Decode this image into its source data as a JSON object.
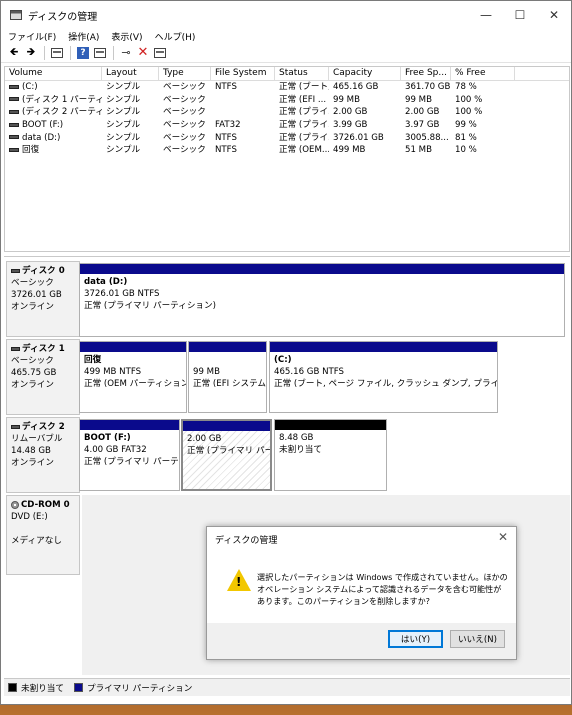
{
  "window": {
    "title": "ディスクの管理",
    "controls": [
      "—",
      "☐",
      "✕"
    ]
  },
  "menu": [
    "ファイル(F)",
    "操作(A)",
    "表示(V)",
    "ヘルプ(H)"
  ],
  "toolbar": {
    "back": "🡸",
    "forward": "🡺"
  },
  "volume_list": {
    "headers": [
      "Volume",
      "Layout",
      "Type",
      "File System",
      "Status",
      "Capacity",
      "Free Sp...",
      "% Free"
    ],
    "rows": [
      [
        "(C:)",
        "シンプル",
        "ベーシック",
        "NTFS",
        "正常 (ブート,...",
        "465.16 GB",
        "361.70 GB",
        "78 %"
      ],
      [
        "(ディスク 1 パーティショ...",
        "シンプル",
        "ベーシック",
        "",
        "正常 (EFI ...",
        "99 MB",
        "99 MB",
        "100 %"
      ],
      [
        "(ディスク 2 パーティショ...",
        "シンプル",
        "ベーシック",
        "",
        "正常 (プライ...",
        "2.00 GB",
        "2.00 GB",
        "100 %"
      ],
      [
        "BOOT (F:)",
        "シンプル",
        "ベーシック",
        "FAT32",
        "正常 (プライ...",
        "3.99 GB",
        "3.97 GB",
        "99 %"
      ],
      [
        "data (D:)",
        "シンプル",
        "ベーシック",
        "NTFS",
        "正常 (プライ...",
        "3726.01 GB",
        "3005.88...",
        "81 %"
      ],
      [
        "回復",
        "シンプル",
        "ベーシック",
        "NTFS",
        "正常 (OEM...",
        "499 MB",
        "51 MB",
        "10 %"
      ]
    ]
  },
  "disks": [
    {
      "name": "ディスク 0",
      "type": "ベーシック",
      "size": "3726.01 GB",
      "status": "オンライン",
      "partitions": [
        {
          "name": "data  (D:)",
          "size": "3726.01 GB NTFS",
          "status": "正常 (プライマリ パーティション)"
        }
      ]
    },
    {
      "name": "ディスク 1",
      "type": "ベーシック",
      "size": "465.75 GB",
      "status": "オンライン",
      "partitions": [
        {
          "name": "回復",
          "size": "499 MB NTFS",
          "status": "正常 (OEM パーティション)"
        },
        {
          "name": "",
          "size": "99 MB",
          "status": "正常 (EFI システム パ"
        },
        {
          "name": "(C:)",
          "size": "465.16 GB NTFS",
          "status": "正常 (ブート, ページ ファイル, クラッシュ ダンプ, プライマリ パーティシ"
        }
      ]
    },
    {
      "name": "ディスク 2",
      "type": "リムーバブル",
      "size": "14.48 GB",
      "status": "オンライン",
      "partitions": [
        {
          "name": "BOOT  (F:)",
          "size": "4.00 GB FAT32",
          "status": "正常 (プライマリ パーティシ"
        },
        {
          "name": "",
          "size": "2.00 GB",
          "status": "正常 (プライマリ パーティ"
        },
        {
          "name": "",
          "size": "8.48 GB",
          "status": "未割り当て"
        }
      ]
    },
    {
      "name": "CD-ROM 0",
      "type": "DVD (E:)",
      "size": "",
      "status": "メディアなし"
    }
  ],
  "legend": [
    {
      "label": "未割り当て",
      "color": "#000000"
    },
    {
      "label": "プライマリ パーティション",
      "color": "#0a0a8c"
    }
  ],
  "dialog": {
    "title": "ディスクの管理",
    "close": "✕",
    "message": "選択したパーティションは Windows で作成されていません。ほかのオペレーション システムによって認識されるデータを含む可能性があります。このパーティションを削除しますか?",
    "yes": "はい(Y)",
    "no": "いいえ(N)"
  }
}
